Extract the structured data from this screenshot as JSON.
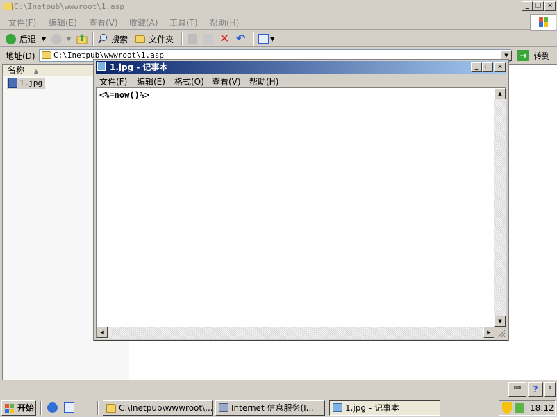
{
  "explorer": {
    "title": "C:\\Inetpub\\wwwroot\\1.asp",
    "menu": [
      "文件(F)",
      "编辑(E)",
      "查看(V)",
      "收藏(A)",
      "工具(T)",
      "帮助(H)"
    ],
    "toolbar": {
      "back": "后退",
      "search": "搜索",
      "folders": "文件夹"
    },
    "address": {
      "label": "地址(D)",
      "value": "C:\\Inetpub\\wwwroot\\1.asp",
      "go": "转到"
    },
    "column_name": "名称",
    "file": "1.jpg"
  },
  "notepad": {
    "title": "1.jpg - 记事本",
    "menu": [
      "文件(F)",
      "编辑(E)",
      "格式(O)",
      "查看(V)",
      "帮助(H)"
    ],
    "content": "<%=now()%>"
  },
  "taskbar": {
    "start": "开始",
    "tasks": [
      "C:\\Inetpub\\wwwroot\\...",
      "Internet 信息服务(I...",
      "1.jpg - 记事本"
    ],
    "clock": "18:12"
  },
  "colors": {
    "title_active": "#0a246a",
    "desktop": "#d4d0c8"
  }
}
